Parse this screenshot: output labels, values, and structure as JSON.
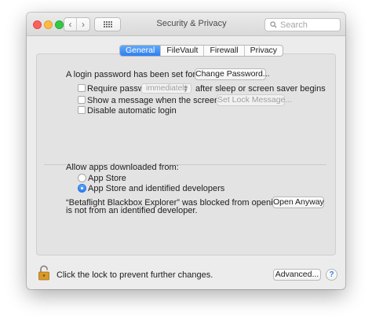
{
  "window": {
    "title": "Security & Privacy"
  },
  "toolbar": {
    "back_icon": "chevron-left-icon",
    "forward_icon": "chevron-right-icon",
    "show_all_icon": "grid-icon"
  },
  "search": {
    "placeholder": "Search",
    "value": ""
  },
  "tabs": [
    {
      "label": "General",
      "active": true
    },
    {
      "label": "FileVault",
      "active": false
    },
    {
      "label": "Firewall",
      "active": false
    },
    {
      "label": "Privacy",
      "active": false
    }
  ],
  "general": {
    "password_text": "A login password has been set for this user",
    "change_password_button": "Change Password...",
    "require_password": {
      "label": "Require password",
      "checked": false,
      "select_value": "immediately",
      "suffix": "after sleep or screen saver begins"
    },
    "show_message": {
      "label": "Show a message when the screen is locked",
      "checked": false,
      "button": "Set Lock Message..."
    },
    "disable_auto_login": {
      "label": "Disable automatic login",
      "checked": false
    },
    "allow_apps": {
      "label": "Allow apps downloaded from:",
      "options": [
        {
          "label": "App Store",
          "selected": false
        },
        {
          "label": "App Store and identified developers",
          "selected": true
        }
      ]
    },
    "blocked_message_line1": "“Betaflight Blackbox Explorer” was blocked from opening because it",
    "blocked_message_line2": "is not from an identified developer.",
    "open_anyway_button": "Open Anyway"
  },
  "footer": {
    "lock_text": "Click the lock to prevent further changes.",
    "advanced_button": "Advanced...",
    "help_label": "?"
  },
  "colors": {
    "accent": "#2e7ef2",
    "window_bg": "#ececec",
    "panel_bg": "#e3e3e3",
    "lock_body": "#d79a2a"
  }
}
